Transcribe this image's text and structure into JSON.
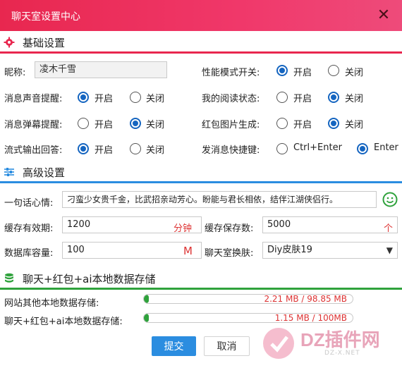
{
  "window": {
    "title": "聊天室设置中心",
    "close_icon": "close-icon"
  },
  "basic": {
    "heading": "基础设置",
    "nickname_label": "昵称:",
    "nickname_value": "凌木千雪",
    "perf_label": "性能模式开关:",
    "sound_label": "消息声音提醒:",
    "read_label": "我的阅读状态:",
    "barrage_label": "消息弹幕提醒:",
    "redpack_label": "红包图片生成:",
    "stream_label": "流式输出回答:",
    "shortcut_label": "发消息快捷键:",
    "on": "开启",
    "off": "关闭",
    "ctrl_enter": "Ctrl+Enter",
    "enter": "Enter",
    "states": {
      "perf": "on",
      "sound": "on",
      "read": "off",
      "barrage": "off",
      "redpack": "off",
      "stream": "on",
      "shortcut": "enter"
    }
  },
  "advanced": {
    "heading": "高级设置",
    "motto_label": "一句话心情:",
    "motto_value": "刁蛮少女贵千金，比武招亲动芳心。盼能与君长相依，结伴江湖侠侣行。",
    "cache_ttl_label": "缓存有效期:",
    "cache_ttl_value": "1200",
    "cache_ttl_unit": "分钟",
    "cache_count_label": "缓存保存数:",
    "cache_count_value": "5000",
    "cache_count_unit": "个",
    "db_label": "数据库容量:",
    "db_value": "100",
    "db_unit": "M",
    "skin_label": "聊天室换肤:",
    "skin_value": "Diy皮肤19"
  },
  "storage": {
    "heading": "聊天+红包+ai本地数据存储",
    "other_label": "网站其他本地数据存储:",
    "other_text": "2.21 MB / 98.85 MB",
    "other_fraction": 0.0224,
    "chat_label": "聊天+红包+ai本地数据存储:",
    "chat_text": "1.15 MB / 100MB",
    "chat_fraction": 0.0115
  },
  "footer": {
    "submit": "提交",
    "cancel": "取消"
  },
  "watermark": {
    "text": "DZ插件网",
    "sub": "DZ-X.NET"
  },
  "colors": {
    "accent_red": "#e8274f",
    "accent_blue": "#2b8de0",
    "accent_green": "#2fa23c"
  }
}
